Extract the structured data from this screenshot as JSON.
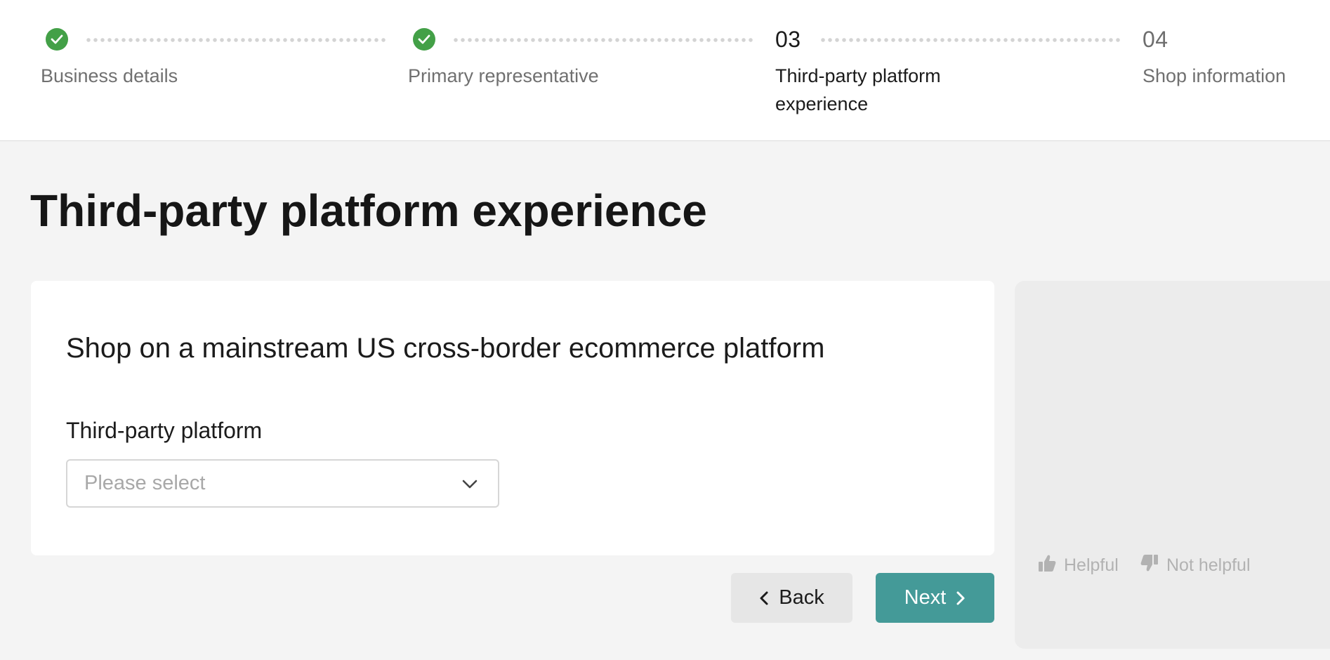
{
  "stepper": {
    "steps": [
      {
        "number": "",
        "label": "Business details",
        "state": "completed",
        "marker_icon": "check-circle-icon"
      },
      {
        "number": "",
        "label": "Primary representative",
        "state": "completed",
        "marker_icon": "check-circle-icon"
      },
      {
        "number": "03",
        "label": "Third-party platform experience",
        "state": "current"
      },
      {
        "number": "04",
        "label": "Shop information",
        "state": "upcoming"
      }
    ]
  },
  "page": {
    "title": "Third-party platform experience"
  },
  "form": {
    "heading": "Shop on a mainstream US cross-border ecommerce platform",
    "platform_field": {
      "label": "Third-party platform",
      "placeholder": "Please select",
      "value": "",
      "icon": "chevron-down-icon"
    }
  },
  "actions": {
    "back_label": "Back",
    "back_icon": "chevron-left-icon",
    "next_label": "Next",
    "next_icon": "chevron-right-icon"
  },
  "side_panel": {
    "helpful_label": "Helpful",
    "helpful_icon": "thumbs-up-icon",
    "not_helpful_label": "Not helpful",
    "not_helpful_icon": "thumbs-down-icon"
  },
  "colors": {
    "accent": "#449a98",
    "completed": "#43a047",
    "background": "#f4f4f4"
  }
}
